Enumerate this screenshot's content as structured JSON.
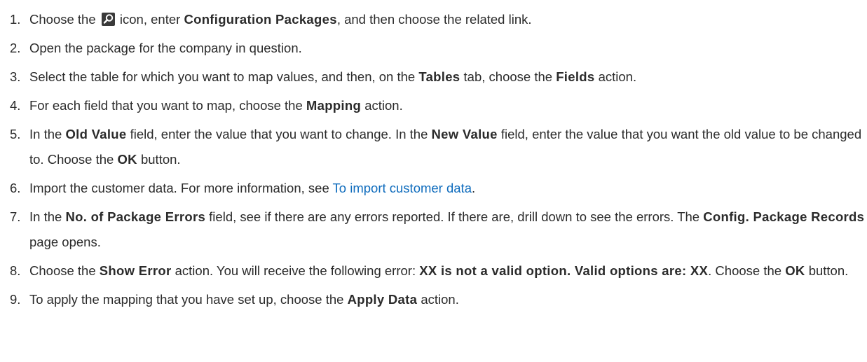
{
  "steps": [
    {
      "number": "1.",
      "t1": "Choose the",
      "icon": "search-icon",
      "t2": "icon, enter",
      "b1": "Configuration Packages",
      "t3": ", and then choose the related link."
    },
    {
      "number": "2.",
      "t1": "Open the package for the company in question."
    },
    {
      "number": "3.",
      "t1": "Select the table for which you want to map values, and then, on the",
      "b1": "Tables",
      "t2": "tab, choose the",
      "b2": "Fields",
      "t3": "action."
    },
    {
      "number": "4.",
      "t1": "For each field that you want to map, choose the",
      "b1": "Mapping",
      "t2": "action."
    },
    {
      "number": "5.",
      "t1": "In the",
      "b1": "Old Value",
      "t2": "field, enter the value that you want to change. In the",
      "b2": "New Value",
      "t3": "field, enter the value that you want the old value to be changed to. Choose the",
      "b3": "OK",
      "t4": "button."
    },
    {
      "number": "6.",
      "t1": "Import the customer data. For more information, see",
      "link": "To import customer data",
      "t2": "."
    },
    {
      "number": "7.",
      "t1": "In the",
      "b1": "No. of Package Errors",
      "t2": "field, see if there are any errors reported. If there are, drill down to see the errors. The",
      "b2": "Config. Package Records",
      "t3": "page opens."
    },
    {
      "number": "8.",
      "t1": "Choose the",
      "b1": "Show Error",
      "t2": "action. You will receive the following error:",
      "b2": "XX is not a valid option. Valid options are: XX",
      "t3": ". Choose the",
      "b3": "OK",
      "t4": "button."
    },
    {
      "number": "9.",
      "t1": "To apply the mapping that you have set up, choose the",
      "b1": "Apply Data",
      "t2": "action."
    }
  ],
  "colors": {
    "text": "#2b2b2b",
    "link": "#0f6cbd"
  }
}
